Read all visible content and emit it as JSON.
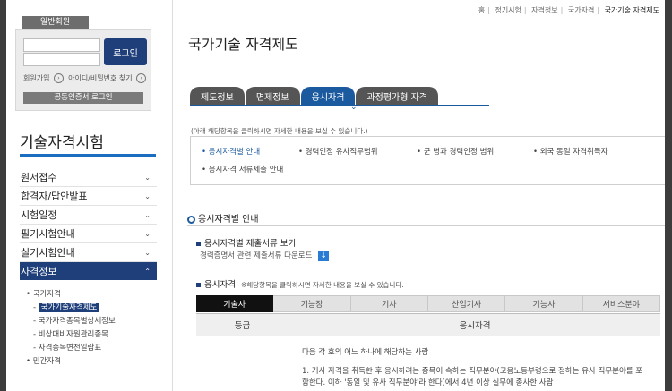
{
  "sidebar": {
    "member_tag": "일반회원",
    "login_button": "로그인",
    "join_link": "회원가입",
    "find_link": "아이디/비밀번호 찾기",
    "cert_login": "공동인증서 로그인",
    "title": "기술자격시험",
    "menu": [
      {
        "label": "원서접수"
      },
      {
        "label": "합격자/답안발표"
      },
      {
        "label": "시험일정"
      },
      {
        "label": "필기시험안내"
      },
      {
        "label": "실기시험안내"
      },
      {
        "label": "자격정보"
      }
    ],
    "submenu": {
      "national": "국가자격",
      "items": [
        "국가기술자격제도",
        "국가자격종목별상세정보",
        "비상대비자원관리종목",
        "자격종목변천일람표"
      ],
      "private": "민간자격"
    }
  },
  "breadcrumb": [
    "홈",
    "정기시험",
    "자격정보",
    "국가자격",
    "국가기술 자격제도"
  ],
  "page_title": "국가기술 자격제도",
  "tabs": [
    "제도정보",
    "면제정보",
    "응시자격",
    "과정평가형 자격"
  ],
  "active_tab": "응시자격",
  "hint": "(아래 해당항목을 클릭하시면 자세한 내용을 보실 수 있습니다.)",
  "sublinks": [
    "응시자격별 안내",
    "경력인정 유사직무범위",
    "군 병과 경력인정 범위",
    "외국 동일 자격취득자",
    "응시자격 서류제출 안내"
  ],
  "section_title": "응시자격별 안내",
  "docs_heading": "응시자격별 제출서류 보기",
  "docs_desc": "경력증명서 관련 제출서류 다운로드",
  "download_icon": "download-icon",
  "req_heading": "응시자격",
  "req_note": "※해당항목을 클릭하시면 자세한 내용을 보실 수 있습니다.",
  "grade_tabs": [
    "기술사",
    "기능장",
    "기사",
    "산업기사",
    "기능사",
    "서비스분야"
  ],
  "table": {
    "headers": [
      "등급",
      "응시자격"
    ],
    "lines": [
      "다음 각 호의 어느 하나에 해당하는 사람",
      "1. 기사 자격을 취득한 후 응시하려는 종목이 속하는 직무분야(고용노동부령으로 정하는 유사 직무분야를 포",
      "함한다. 이하 '동일 및 유사 직무분야'라 한다)에서 4년 이상 실무에 종사한 사람"
    ]
  },
  "colors": {
    "primary": "#1f3f7a",
    "accent": "#1b5a9e",
    "tab_dark": "#555555"
  }
}
